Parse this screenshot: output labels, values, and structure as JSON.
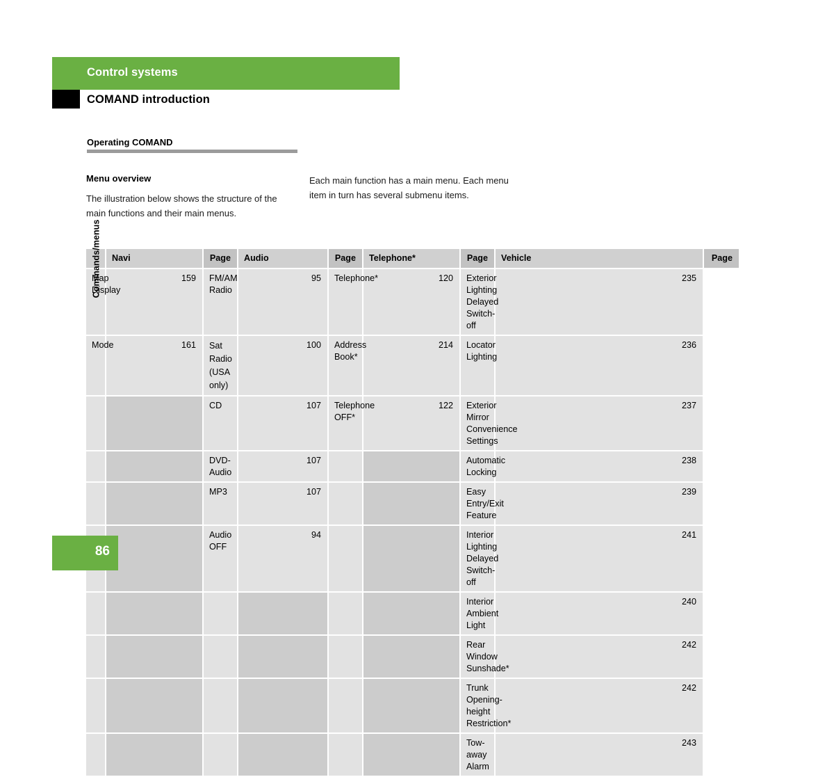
{
  "header": {
    "chapter": "Control systems",
    "section": "COMAND introduction"
  },
  "subhead": "Operating COMAND",
  "intro": {
    "left_heading": "Menu overview",
    "left_text": "The illustration below shows the structure of the main functions and their main menus.",
    "right_text": "Each main function has a main menu. Each menu item in turn has several submenu items."
  },
  "table": {
    "side_label": "Commands/menus",
    "columns": [
      {
        "name": "Navi",
        "page": "Page"
      },
      {
        "name": "Audio",
        "page": "Page"
      },
      {
        "name": "Telephone*",
        "page": "Page"
      },
      {
        "name": "Vehicle",
        "page": "Page"
      }
    ],
    "rows": [
      {
        "navi": "Map Display",
        "navi_page": "159",
        "audio": "FM/AM Radio",
        "audio_page": "95",
        "phone": "Telephone*",
        "phone_page": "120",
        "vehicle": "Exterior Lighting Delayed Switch-off",
        "vehicle_page": "235"
      },
      {
        "navi": "Mode",
        "navi_page": "161",
        "audio": "Sat Radio\n(USA only)",
        "audio_page": "100",
        "phone": "Address Book*",
        "phone_page": "214",
        "vehicle": "Locator Lighting",
        "vehicle_page": "236"
      },
      {
        "navi": "",
        "navi_page": "",
        "audio": "CD",
        "audio_page": "107",
        "phone": "Telephone OFF*",
        "phone_page": "122",
        "vehicle": "Exterior Mirror Convenience Settings",
        "vehicle_page": "237"
      },
      {
        "navi": "",
        "navi_page": "",
        "audio": "DVD-Audio",
        "audio_page": "107",
        "phone": "",
        "phone_page": "",
        "vehicle": "Automatic Locking",
        "vehicle_page": "238"
      },
      {
        "navi": "",
        "navi_page": "",
        "audio": "MP3",
        "audio_page": "107",
        "phone": "",
        "phone_page": "",
        "vehicle": "Easy Entry/Exit Feature",
        "vehicle_page": "239"
      },
      {
        "navi": "",
        "navi_page": "",
        "audio": "Audio OFF",
        "audio_page": "94",
        "phone": "",
        "phone_page": "",
        "vehicle": "Interior Lighting Delayed Switch-off",
        "vehicle_page": "241"
      },
      {
        "navi": "",
        "navi_page": "",
        "audio": "",
        "audio_page": "",
        "phone": "",
        "phone_page": "",
        "vehicle": "Interior Ambient Light",
        "vehicle_page": "240"
      },
      {
        "navi": "",
        "navi_page": "",
        "audio": "",
        "audio_page": "",
        "phone": "",
        "phone_page": "",
        "vehicle": "Rear Window Sunshade*",
        "vehicle_page": "242"
      },
      {
        "navi": "",
        "navi_page": "",
        "audio": "",
        "audio_page": "",
        "phone": "",
        "phone_page": "",
        "vehicle": "Trunk Opening-height Restriction*",
        "vehicle_page": "242"
      },
      {
        "navi": "",
        "navi_page": "",
        "audio": "",
        "audio_page": "",
        "phone": "",
        "phone_page": "",
        "vehicle": "Tow-away Alarm",
        "vehicle_page": "243"
      }
    ]
  },
  "footer": {
    "page_number": "86"
  },
  "colors": {
    "accent_green": "#6ab043",
    "tab_black": "#000000",
    "rule_gray": "#9b9b9b",
    "table_cell": "#e2e2e2",
    "table_page_cell": "#cccccc",
    "table_head": "#d0d0d0"
  }
}
